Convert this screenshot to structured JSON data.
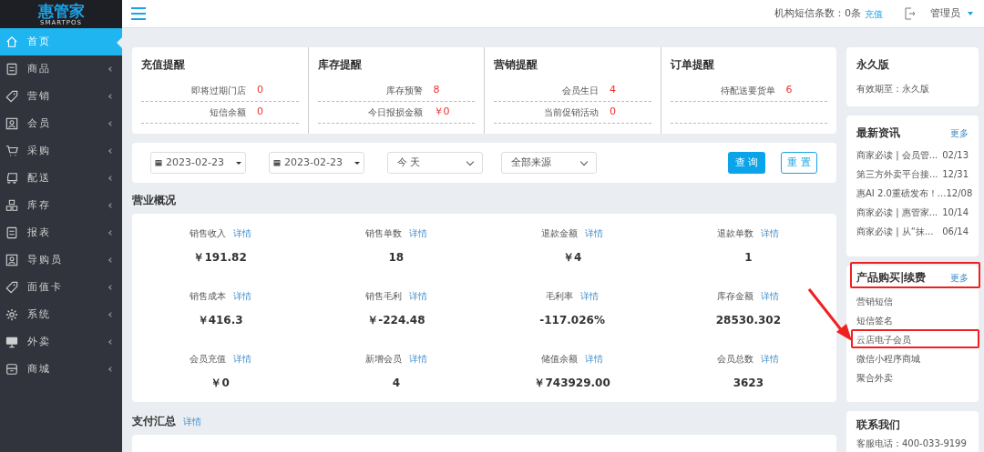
{
  "logo": {
    "title": "惠管家",
    "subtitle": "SMARTPOS"
  },
  "sidebar": {
    "items": [
      {
        "label": "首页",
        "kind": "home",
        "selected": true
      },
      {
        "label": "商品",
        "kind": "doc",
        "selected": false
      },
      {
        "label": "营销",
        "kind": "tag",
        "selected": false
      },
      {
        "label": "会员",
        "kind": "person",
        "selected": false
      },
      {
        "label": "采购",
        "kind": "cart",
        "selected": false
      },
      {
        "label": "配送",
        "kind": "truck",
        "selected": false
      },
      {
        "label": "库存",
        "kind": "boxes",
        "selected": false
      },
      {
        "label": "报表",
        "kind": "doc",
        "selected": false
      },
      {
        "label": "导购员",
        "kind": "person",
        "selected": false
      },
      {
        "label": "面值卡",
        "kind": "tag",
        "selected": false
      },
      {
        "label": "系统",
        "kind": "gear",
        "selected": false
      },
      {
        "label": "外卖",
        "kind": "monitor",
        "selected": false
      },
      {
        "label": "商城",
        "kind": "store",
        "selected": false
      }
    ]
  },
  "header": {
    "sms_label": "机构短信条数：0条",
    "recharge": "充值",
    "user": "管理员"
  },
  "reminders": [
    {
      "title": "充值提醒",
      "rows": [
        {
          "label": "即将过期门店",
          "value": "0"
        },
        {
          "label": "短信余额",
          "value": "0"
        }
      ]
    },
    {
      "title": "库存提醒",
      "rows": [
        {
          "label": "库存预警",
          "value": "8"
        },
        {
          "label": "今日报损金额",
          "value": "￥0"
        }
      ]
    },
    {
      "title": "营销提醒",
      "rows": [
        {
          "label": "会员生日",
          "value": "4"
        },
        {
          "label": "当前促销活动",
          "value": "0"
        }
      ]
    },
    {
      "title": "订单提醒",
      "rows": [
        {
          "label": "待配送要货单",
          "value": "6"
        }
      ]
    }
  ],
  "filters": {
    "date_from": "2023-02-23",
    "date_to": "2023-02-23",
    "period": "今 天",
    "source": "全部来源",
    "query": "查 询",
    "reset": "重 置"
  },
  "overview": {
    "title": "营业概况",
    "stats": [
      {
        "label": "销售收入",
        "detail": "详情",
        "value": "￥191.82"
      },
      {
        "label": "销售单数",
        "detail": "详情",
        "value": "18"
      },
      {
        "label": "退款金额",
        "detail": "详情",
        "value": "￥4"
      },
      {
        "label": "退款单数",
        "detail": "详情",
        "value": "1"
      },
      {
        "label": "销售成本",
        "detail": "详情",
        "value": "￥416.3"
      },
      {
        "label": "销售毛利",
        "detail": "详情",
        "value": "￥-224.48"
      },
      {
        "label": "毛利率",
        "detail": "详情",
        "value": "-117.026%"
      },
      {
        "label": "库存金额",
        "detail": "详情",
        "value": "28530.302"
      },
      {
        "label": "会员充值",
        "detail": "详情",
        "value": "￥0"
      },
      {
        "label": "新增会员",
        "detail": "详情",
        "value": "4"
      },
      {
        "label": "储值余额",
        "detail": "详情",
        "value": "￥743929.00"
      },
      {
        "label": "会员总数",
        "detail": "详情",
        "value": "3623"
      }
    ]
  },
  "payment": {
    "title": "支付汇总",
    "detail": "详情"
  },
  "edition": {
    "title": "永久版",
    "text": "有效期至：永久版"
  },
  "news": {
    "title": "最新资讯",
    "more": "更多",
    "items": [
      {
        "title": "商家必读 | 会员管...",
        "date": "02/13"
      },
      {
        "title": "第三方外卖平台接...",
        "date": "12/31"
      },
      {
        "title": "惠AI 2.0重磅发布！...",
        "date": "12/08"
      },
      {
        "title": "商家必读 | 惠管家...",
        "date": "10/14"
      },
      {
        "title": "商家必读 | 从“抹...",
        "date": "06/14"
      }
    ]
  },
  "purchase": {
    "title": "产品购买|续费",
    "more": "更多",
    "items": [
      "营销短信",
      "短信签名",
      "云店电子会员",
      "微信小程序商城",
      "聚合外卖"
    ]
  },
  "contact": {
    "title": "联系我们",
    "phone": "客服电话：400-033-9199"
  }
}
